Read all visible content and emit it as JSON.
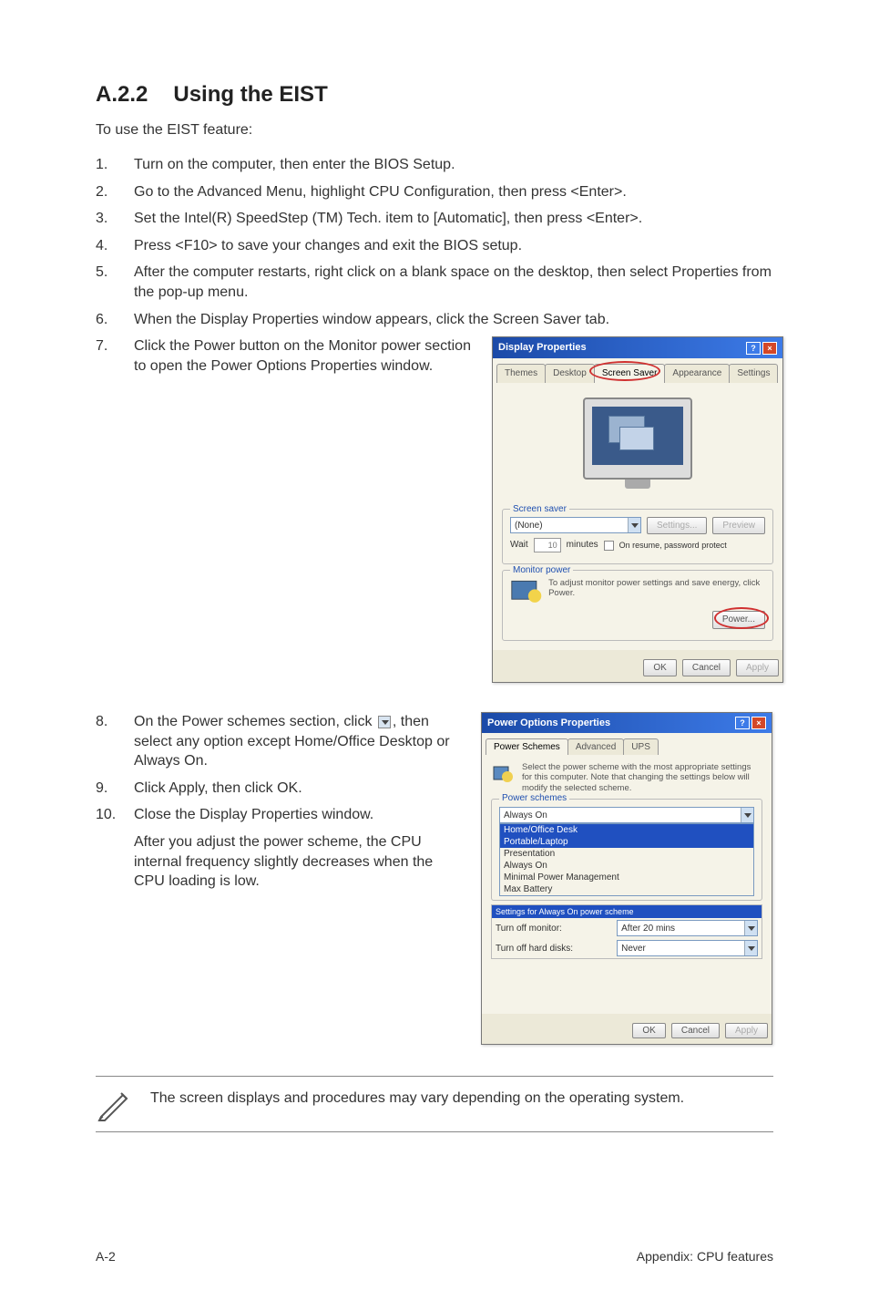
{
  "section": {
    "number": "A.2.2",
    "title": "Using the EIST"
  },
  "intro": "To use the EIST feature:",
  "steps_top": [
    {
      "n": "1.",
      "t": "Turn on the computer, then enter the BIOS Setup."
    },
    {
      "n": "2.",
      "t": "Go to the Advanced Menu, highlight CPU Configuration, then press <Enter>."
    },
    {
      "n": "3.",
      "t": "Set the Intel(R) SpeedStep (TM) Tech. item to [Automatic], then press <Enter>."
    },
    {
      "n": "4.",
      "t": "Press <F10> to save your changes and exit the BIOS setup."
    },
    {
      "n": "5.",
      "t": "After the computer restarts, right click on a blank space on the desktop, then select Properties from the pop-up menu."
    },
    {
      "n": "6.",
      "t": "When the Display Properties window appears, click the Screen Saver tab."
    }
  ],
  "step7": {
    "n": "7.",
    "t": "Click the Power button on the Monitor power section to open the Power Options Properties window."
  },
  "steps_bottom": [
    {
      "n": "8.",
      "t_before": "On the Power schemes section, click ",
      "t_after": ", then select any option except Home/Office Desktop or Always On."
    },
    {
      "n": "9.",
      "t": "Click Apply, then click OK."
    },
    {
      "n": "10.",
      "t": "Close the Display Properties window."
    }
  ],
  "after_adjust": "After you adjust the power scheme, the CPU internal frequency slightly decreases when the CPU loading is low.",
  "note": "The screen displays and procedures may vary depending on the operating system.",
  "footer": {
    "left": "A-2",
    "right": "Appendix: CPU features"
  },
  "dialog1": {
    "title": "Display Properties",
    "tabs": [
      "Themes",
      "Desktop",
      "Screen Saver",
      "Appearance",
      "Settings"
    ],
    "screensaver_legend": "Screen saver",
    "screensaver_value": "(None)",
    "btn_settings": "Settings...",
    "btn_preview": "Preview",
    "wait_label": "Wait",
    "wait_value": "10",
    "wait_unit": "minutes",
    "wait_check": "On resume, password protect",
    "monitor_legend": "Monitor power",
    "monitor_desc": "To adjust monitor power settings and save energy, click Power.",
    "btn_power": "Power...",
    "btn_ok": "OK",
    "btn_cancel": "Cancel",
    "btn_apply": "Apply"
  },
  "dialog2": {
    "title": "Power Options Properties",
    "tabs": [
      "Power Schemes",
      "Advanced",
      "UPS"
    ],
    "desc": "Select the power scheme with the most appropriate settings for this computer. Note that changing the settings below will modify the selected scheme.",
    "schemes_legend": "Power schemes",
    "selected": "Always On",
    "options": [
      "Home/Office Desk",
      "Portable/Laptop",
      "Presentation",
      "Always On",
      "Minimal Power Management",
      "Max Battery"
    ],
    "settings_legend": "Settings for Always On power scheme",
    "row1_label": "Turn off monitor:",
    "row1_value": "After 20 mins",
    "row2_label": "Turn off hard disks:",
    "row2_value": "Never",
    "btn_ok": "OK",
    "btn_cancel": "Cancel",
    "btn_apply": "Apply"
  }
}
